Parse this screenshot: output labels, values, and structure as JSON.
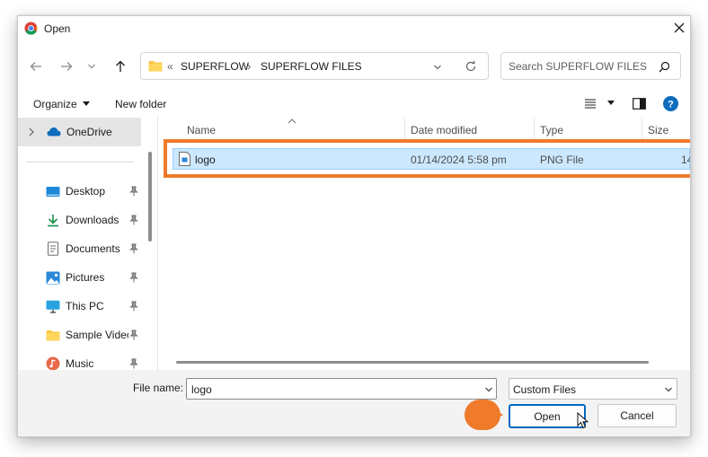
{
  "window": {
    "title": "Open",
    "title_icon": "chrome-icon",
    "close_icon": "close-icon"
  },
  "nav": {
    "back_icon": "arrow-left-icon",
    "forward_icon": "arrow-right-icon",
    "recent_icon": "chevron-down-icon",
    "up_icon": "arrow-up-icon",
    "breadcrumb": {
      "overflow": "«",
      "items": [
        "SUPERFLOW",
        "SUPERFLOW FILES"
      ],
      "separator": "›"
    },
    "refresh_icon": "refresh-icon",
    "search_placeholder": "Search SUPERFLOW FILES"
  },
  "toolbar": {
    "organize_label": "Organize",
    "new_folder_label": "New folder"
  },
  "sidebar": {
    "onedrive_label": "OneDrive",
    "items": [
      {
        "label": "Desktop",
        "icon": "desktop-icon"
      },
      {
        "label": "Downloads",
        "icon": "download-icon"
      },
      {
        "label": "Documents",
        "icon": "documents-icon"
      },
      {
        "label": "Pictures",
        "icon": "pictures-icon"
      },
      {
        "label": "This PC",
        "icon": "monitor-icon"
      },
      {
        "label": "Sample Videos",
        "icon": "folder-icon"
      },
      {
        "label": "Music",
        "icon": "music-icon"
      }
    ]
  },
  "columns": {
    "name": "Name",
    "date": "Date modified",
    "type": "Type",
    "size": "Size"
  },
  "files": [
    {
      "name": "logo",
      "date": "01/14/2024 5:58 pm",
      "type": "PNG File",
      "size": "14"
    }
  ],
  "footer": {
    "file_name_label": "File name:",
    "file_name_value": "logo",
    "filter_value": "Custom Files",
    "open_label": "Open",
    "cancel_label": "Cancel"
  },
  "colors": {
    "accent": "#0067c0",
    "selection": "#cce8ff",
    "highlight": "#ee7a2a"
  }
}
